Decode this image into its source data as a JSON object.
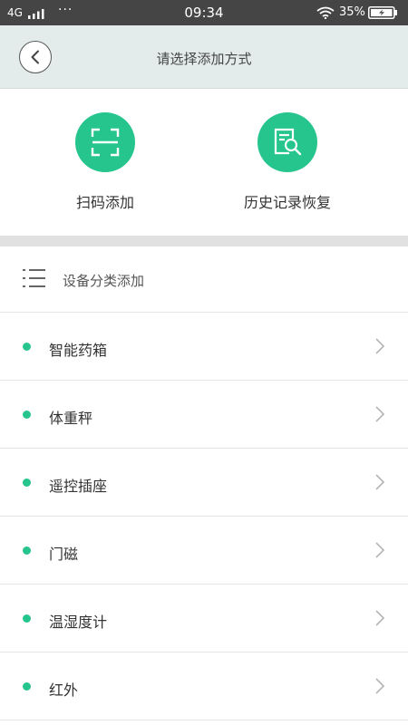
{
  "status_bar": {
    "network": "4G",
    "dots": "···",
    "time": "09:34",
    "battery": "35%"
  },
  "header": {
    "title": "请选择添加方式"
  },
  "add_methods": [
    {
      "label": "扫码添加",
      "icon": "scan-icon"
    },
    {
      "label": "历史记录恢复",
      "icon": "history-search-icon"
    }
  ],
  "category_section": {
    "label": "设备分类添加",
    "icon": "list-icon"
  },
  "categories": [
    {
      "label": "智能药箱"
    },
    {
      "label": "体重秤"
    },
    {
      "label": "遥控插座"
    },
    {
      "label": "门磁"
    },
    {
      "label": "温湿度计"
    },
    {
      "label": "红外"
    }
  ],
  "colors": {
    "accent": "#26c58d",
    "header_bg": "#e3eceb",
    "status_bar_bg": "#454545"
  }
}
